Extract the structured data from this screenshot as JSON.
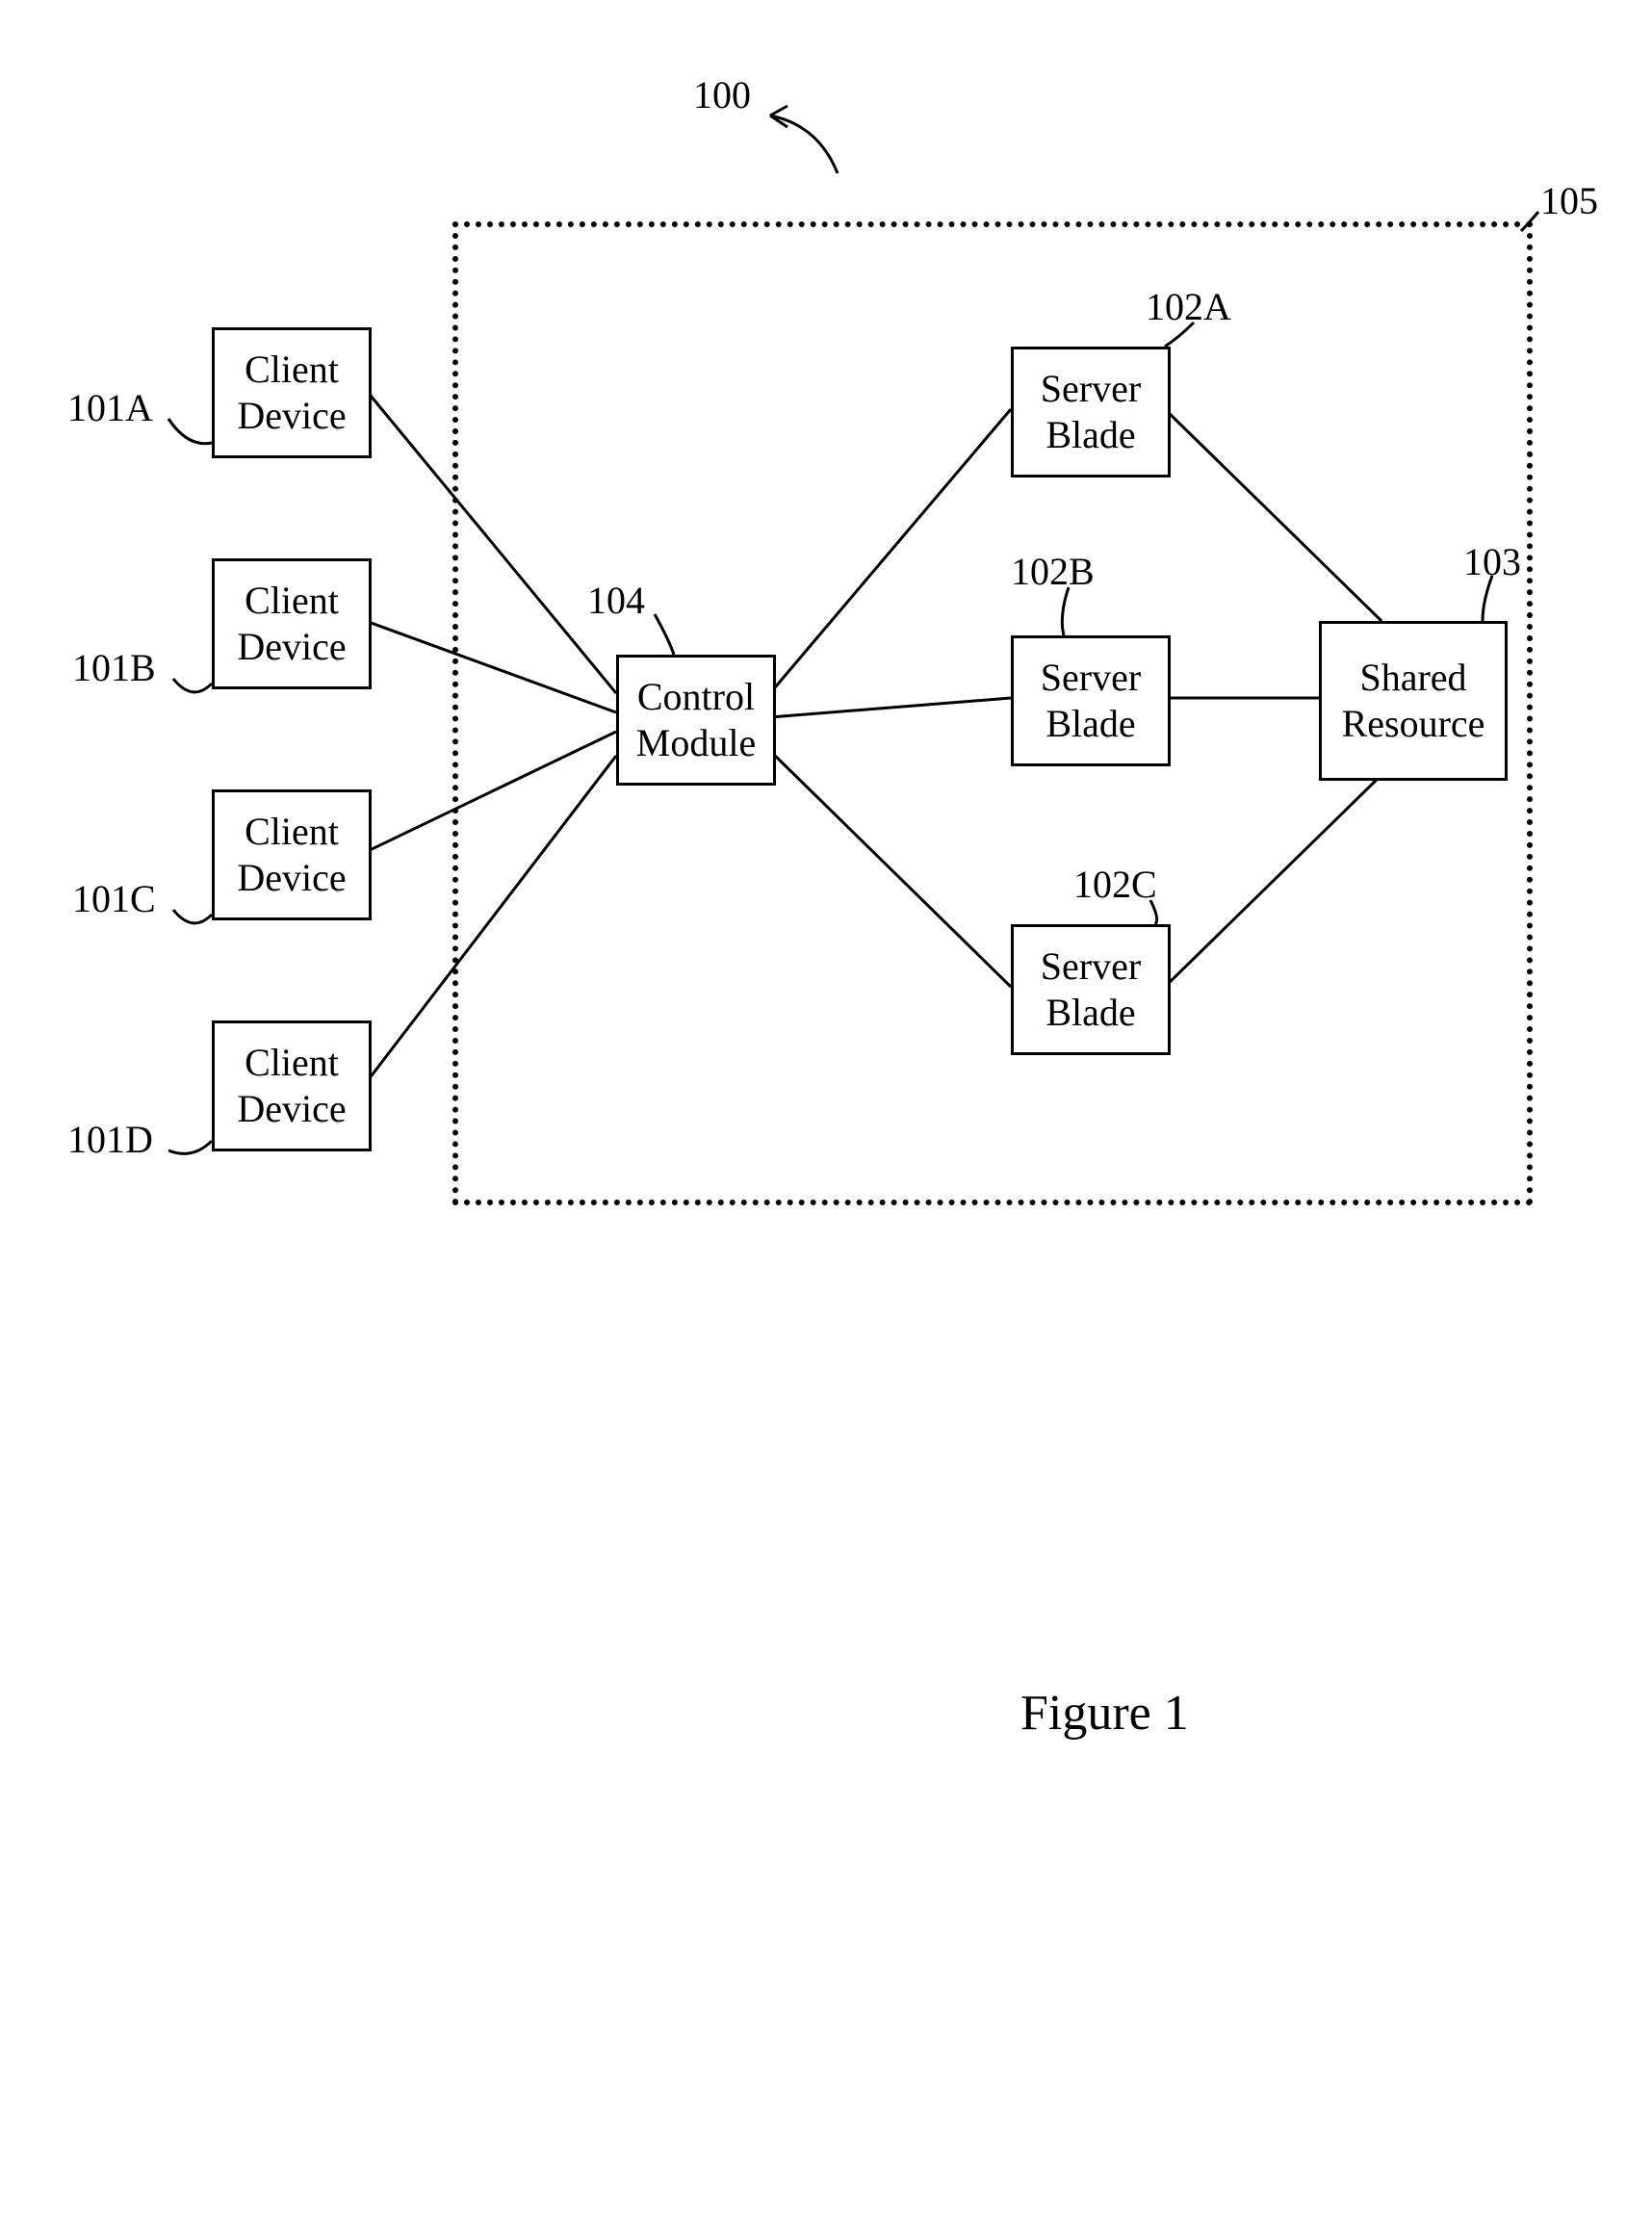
{
  "labels": {
    "system": "100",
    "enclosure": "105",
    "clientA": "101A",
    "clientB": "101B",
    "clientC": "101C",
    "clientD": "101D",
    "control": "104",
    "bladeA": "102A",
    "bladeB": "102B",
    "bladeC": "102C",
    "shared": "103",
    "figure": "Figure 1"
  },
  "boxes": {
    "clientDevice": "Client\nDevice",
    "controlModule": "Control\nModule",
    "serverBlade": "Server\nBlade",
    "sharedResource": "Shared\nResource"
  }
}
